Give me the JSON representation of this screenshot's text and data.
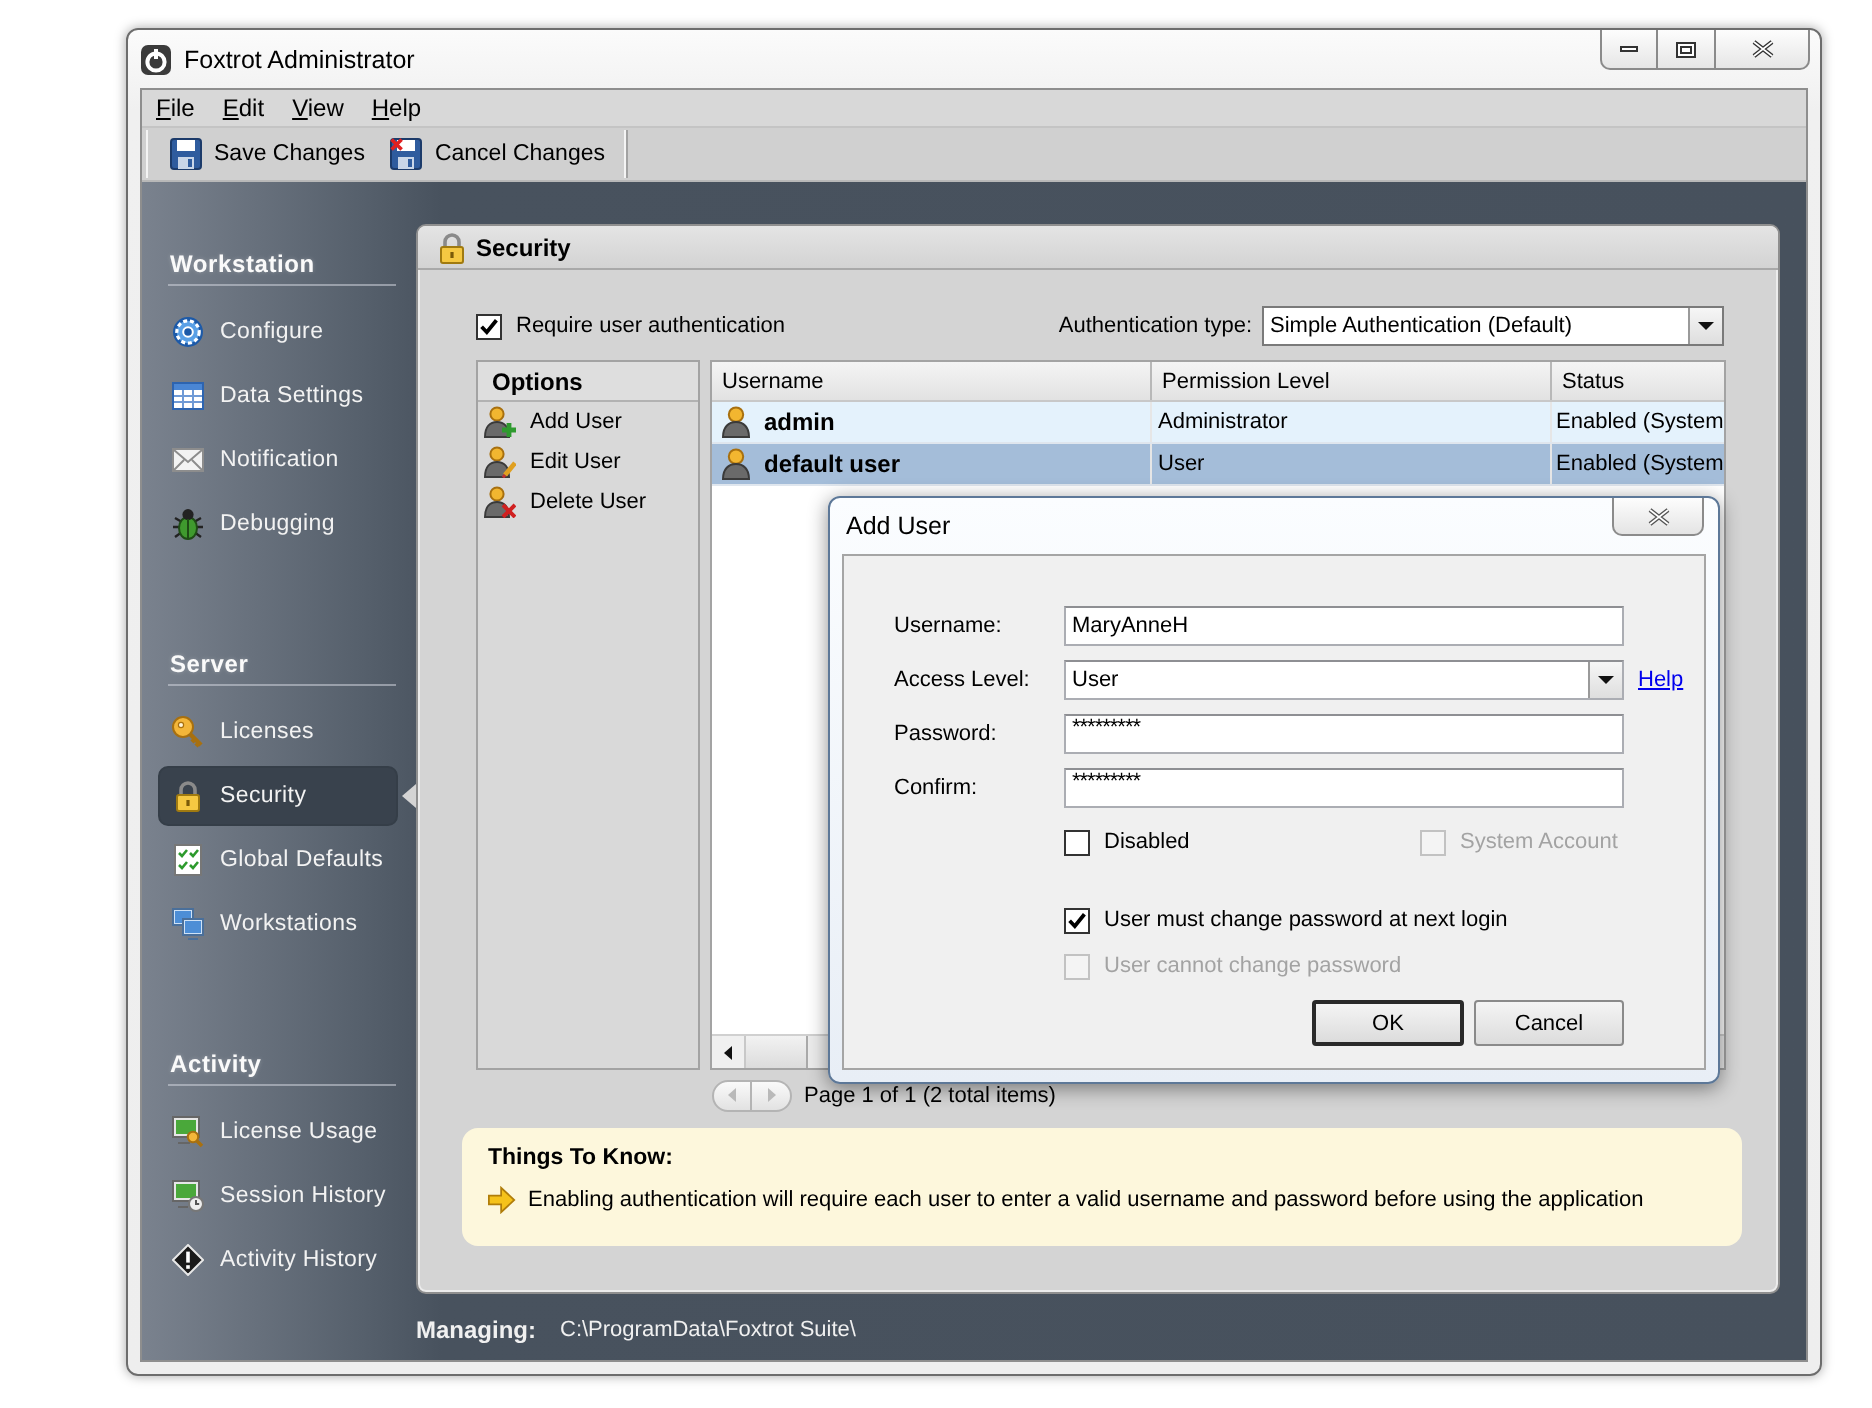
{
  "window": {
    "title": "Foxtrot Administrator"
  },
  "menu": [
    "File",
    "Edit",
    "View",
    "Help"
  ],
  "toolbar": [
    {
      "label": "Save Changes",
      "kind": "save"
    },
    {
      "label": "Cancel Changes",
      "kind": "cancel"
    }
  ],
  "sidebar": {
    "sections": [
      {
        "title": "Workstation",
        "items": [
          {
            "label": "Configure",
            "kind": "gear",
            "selected": false
          },
          {
            "label": "Data Settings",
            "kind": "grid",
            "selected": false
          },
          {
            "label": "Notification",
            "kind": "envelope",
            "selected": false
          },
          {
            "label": "Debugging",
            "kind": "bug",
            "selected": false
          }
        ]
      },
      {
        "title": "Server",
        "items": [
          {
            "label": "Licenses",
            "kind": "key",
            "selected": false
          },
          {
            "label": "Security",
            "kind": "padlock",
            "selected": true
          },
          {
            "label": "Global Defaults",
            "kind": "checklist",
            "selected": false
          },
          {
            "label": "Workstations",
            "kind": "monitors",
            "selected": false
          }
        ]
      },
      {
        "title": "Activity",
        "items": [
          {
            "label": "License Usage",
            "kind": "monitor-key",
            "selected": false
          },
          {
            "label": "Session History",
            "kind": "monitor-clock",
            "selected": false
          },
          {
            "label": "Activity History",
            "kind": "warning",
            "selected": false
          }
        ]
      }
    ]
  },
  "panel": {
    "title": "Security",
    "require_auth": {
      "label": "Require user authentication",
      "checked": true
    },
    "auth_type": {
      "label": "Authentication type:",
      "value": "Simple Authentication (Default)"
    },
    "options": {
      "title": "Options",
      "items": [
        {
          "label": "Add User",
          "kind": "add"
        },
        {
          "label": "Edit User",
          "kind": "edit"
        },
        {
          "label": "Delete User",
          "kind": "delete"
        }
      ]
    },
    "table": {
      "columns": [
        "Username",
        "Permission Level",
        "Status"
      ],
      "rows": [
        {
          "cells": [
            "admin",
            "Administrator",
            "Enabled (System"
          ],
          "highlighted": true,
          "selected": false
        },
        {
          "cells": [
            "default user",
            "User",
            "Enabled (System"
          ],
          "highlighted": false,
          "selected": true
        }
      ]
    },
    "pager": {
      "label": "Page 1 of 1 (2 total items)",
      "buttons": [
        {
          "kind": "prev",
          "disabled": true
        },
        {
          "kind": "next",
          "disabled": true
        }
      ]
    },
    "tips": {
      "title": "Things To Know:",
      "items": [
        "Enabling authentication will require each user to enter a valid username and password before using the application"
      ]
    }
  },
  "status_bar": {
    "label": "Managing:",
    "value": "C:\\ProgramData\\Foxtrot Suite\\"
  },
  "dialog": {
    "title": "Add User",
    "fields": [
      {
        "label": "Username:",
        "value": "MaryAnneH",
        "kind": "text"
      },
      {
        "label": "Access Level:",
        "value": "User",
        "kind": "select"
      },
      {
        "label": "Password:",
        "value": "*********",
        "kind": "password"
      },
      {
        "label": "Confirm:",
        "value": "*********",
        "kind": "password"
      }
    ],
    "help_link": "Help",
    "checkbox_rows": [
      [
        {
          "label": "Disabled",
          "checked": false,
          "disabled": false
        },
        {
          "label": "System Account",
          "checked": false,
          "disabled": true
        }
      ],
      [
        {
          "label": "User must change password at next login",
          "checked": true,
          "disabled": false
        }
      ],
      [
        {
          "label": "User cannot change password",
          "checked": false,
          "disabled": true
        }
      ]
    ],
    "buttons": [
      {
        "label": "OK",
        "default": true
      },
      {
        "label": "Cancel",
        "default": false
      }
    ]
  }
}
